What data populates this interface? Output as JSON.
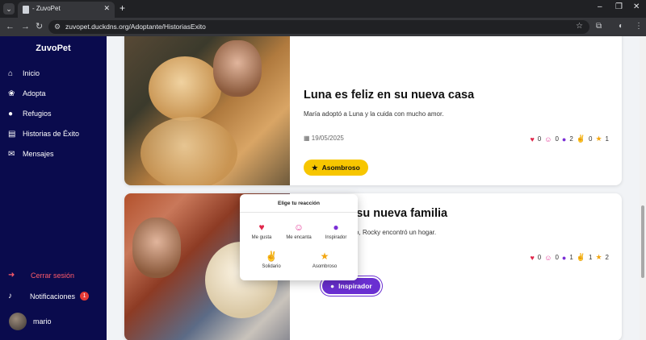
{
  "browser": {
    "tab_title": "- ZuvoPet",
    "url": "zuvopet.duckdns.org/Adoptante/HistoriasExito"
  },
  "sidebar": {
    "brand": "ZuvoPet",
    "items": [
      {
        "label": "Inicio",
        "icon": "home-icon"
      },
      {
        "label": "Adopta",
        "icon": "paw-icon"
      },
      {
        "label": "Refugios",
        "icon": "location-pin-icon"
      },
      {
        "label": "Historias de Éxito",
        "icon": "book-icon"
      },
      {
        "label": "Mensajes",
        "icon": "chat-icon"
      }
    ],
    "logout_label": "Cerrar sesión",
    "notifications_label": "Notificaciones",
    "notifications_count": "1",
    "user_name": "mario"
  },
  "stories": [
    {
      "title": "Luna es feliz en su nueva casa",
      "description": "María adoptó a Luna y la cuida con mucho amor.",
      "date": "19/05/2025",
      "reactions": {
        "me_gusta": "0",
        "me_encanta": "0",
        "inspirador": "2",
        "solidario": "0",
        "asombroso": "1"
      },
      "badge": "Asombroso"
    },
    {
      "title": "sfruta de su nueva familia",
      "description": "ente fue rechazado, Rocky encontró un hogar.",
      "reactions": {
        "me_gusta": "0",
        "me_encanta": "0",
        "inspirador": "1",
        "solidario": "1",
        "asombroso": "2"
      },
      "badge": "Inspirador"
    }
  ],
  "reaction_popover": {
    "title": "Elige tu reacción",
    "options": [
      "Me gusta",
      "Me encanta",
      "Inspirador",
      "Solidario",
      "Asombroso"
    ]
  },
  "colors": {
    "sidebar_bg": "#0a0b4d",
    "heart": "#e0264a",
    "smile": "#e5409b",
    "bulb": "#7b2fd6",
    "handshake": "#1f8a3b",
    "star": "#f3a712",
    "badge_yellow": "#f7c600",
    "badge_purple": "#6a2fd1",
    "logout": "#ff5b6a"
  }
}
